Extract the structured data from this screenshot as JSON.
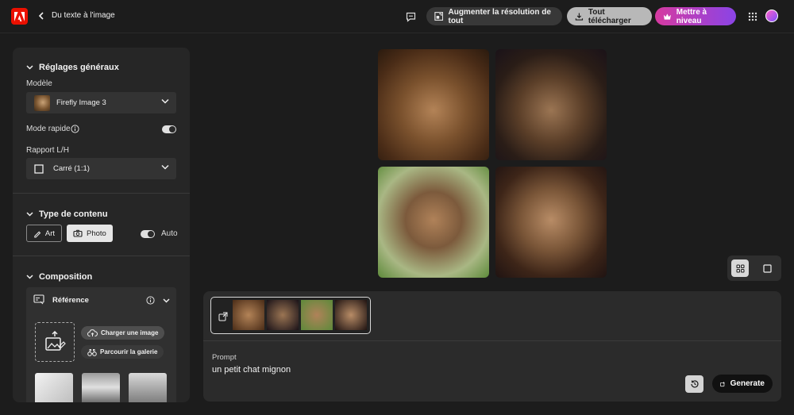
{
  "topbar": {
    "breadcrumb": "Du texte à l'image",
    "upscale_label": "Augmenter la résolution de tout",
    "download_label": "Tout télécharger",
    "upgrade_label": "Mettre à niveau"
  },
  "sidebar": {
    "general": {
      "title": "Réglages généraux",
      "model_label": "Modèle",
      "model_value": "Firefly Image 3",
      "fast_mode_label": "Mode rapide",
      "fast_mode_on": true,
      "ratio_label": "Rapport L/H",
      "ratio_value": "Carré (1:1)"
    },
    "content_type": {
      "title": "Type de contenu",
      "art_label": "Art",
      "photo_label": "Photo",
      "selected": "Photo",
      "auto_label": "Auto",
      "auto_on": true
    },
    "composition": {
      "title": "Composition",
      "reference_label": "Référence",
      "upload_label": "Charger une image",
      "browse_label": "Parcourir la galerie"
    }
  },
  "prompt_panel": {
    "prompt_label": "Prompt",
    "prompt_value": "un petit chat mignon",
    "generate_label": "Generate"
  },
  "view": {
    "selected": "grid"
  },
  "colors": {
    "accent_red": "#eb1000",
    "upgrade_gradient_start": "#d63aa0",
    "upgrade_gradient_end": "#8a44e6"
  }
}
